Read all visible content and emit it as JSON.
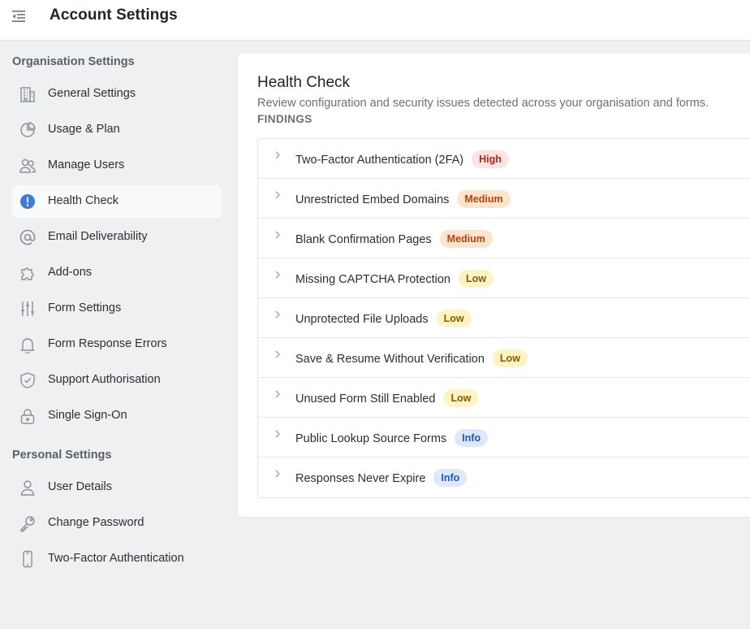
{
  "header": {
    "title": "Account Settings",
    "menu_icon": "collapse-menu-icon"
  },
  "sidebar": {
    "organisation_heading": "Organisation Settings",
    "organisation_items": [
      {
        "label": "General Settings",
        "icon": "building-icon"
      },
      {
        "label": "Usage & Plan",
        "icon": "pie-chart-icon"
      },
      {
        "label": "Manage Users",
        "icon": "users-icon"
      },
      {
        "label": "Health Check",
        "icon": "alert-circle-icon",
        "active": true
      },
      {
        "label": "Email Deliverability",
        "icon": "at-sign-icon"
      },
      {
        "label": "Add-ons",
        "icon": "puzzle-icon"
      },
      {
        "label": "Form Settings",
        "icon": "sliders-icon"
      },
      {
        "label": "Form Response Errors",
        "icon": "bell-icon"
      },
      {
        "label": "Support Authorisation",
        "icon": "shield-check-icon"
      },
      {
        "label": "Single Sign-On",
        "icon": "lock-icon"
      }
    ],
    "personal_heading": "Personal Settings",
    "personal_items": [
      {
        "label": "User Details",
        "icon": "user-icon"
      },
      {
        "label": "Change Password",
        "icon": "key-icon"
      },
      {
        "label": "Two-Factor Authentication",
        "icon": "smartphone-icon"
      }
    ]
  },
  "main": {
    "title": "Health Check",
    "description": "Review configuration and security issues detected across your organisation and forms.",
    "findings_label": "FINDINGS",
    "findings": [
      {
        "title": "Two-Factor Authentication (2FA)",
        "severity": "High"
      },
      {
        "title": "Unrestricted Embed Domains",
        "severity": "Medium"
      },
      {
        "title": "Blank Confirmation Pages",
        "severity": "Medium"
      },
      {
        "title": "Missing CAPTCHA Protection",
        "severity": "Low"
      },
      {
        "title": "Unprotected File Uploads",
        "severity": "Low"
      },
      {
        "title": "Save & Resume Without Verification",
        "severity": "Low"
      },
      {
        "title": "Unused Form Still Enabled",
        "severity": "Low"
      },
      {
        "title": "Public Lookup Source Forms",
        "severity": "Info"
      },
      {
        "title": "Responses Never Expire",
        "severity": "Info"
      }
    ]
  },
  "colors": {
    "active_icon": "#3b7dd8",
    "high": "#b3261e",
    "medium": "#b3440e",
    "low": "#8a5a00",
    "info": "#1f56b8"
  }
}
